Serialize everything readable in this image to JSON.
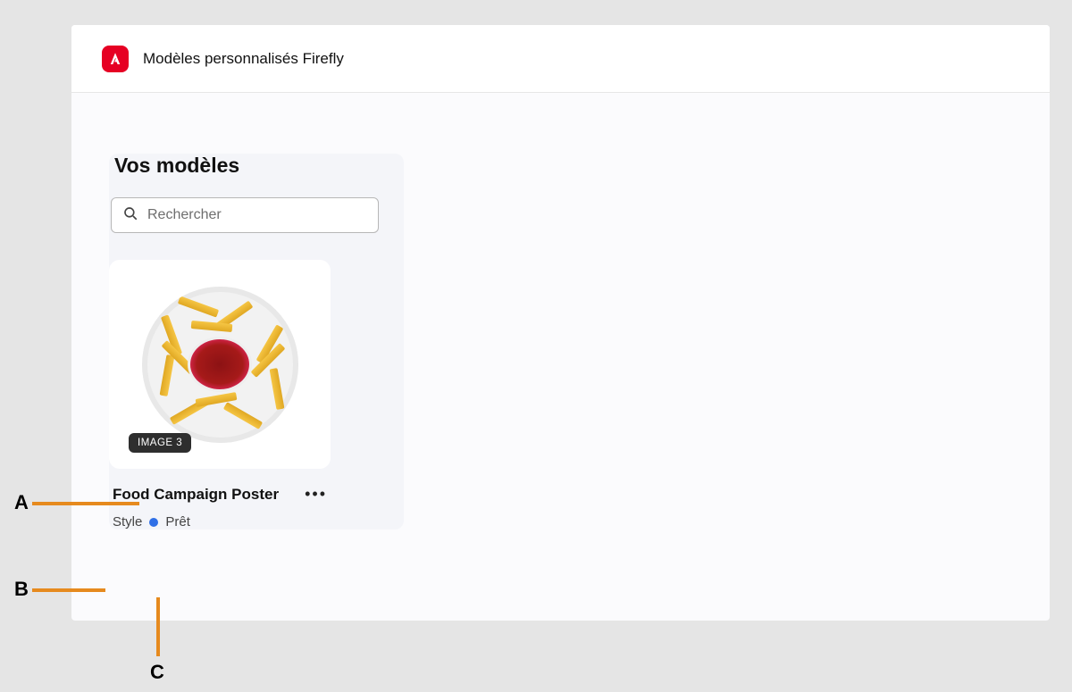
{
  "header": {
    "app_title": "Modèles personnalisés Firefly"
  },
  "sidebar": {
    "section_title": "Vos modèles",
    "search_placeholder": "Rechercher"
  },
  "model_card": {
    "badge": "IMAGE 3",
    "title": "Food Campaign Poster",
    "type_label": "Style",
    "status_label": "Prêt",
    "status_color": "#2f6fe6"
  },
  "annotations": {
    "a": "A",
    "b": "B",
    "c": "C"
  },
  "colors": {
    "accent_orange": "#e68a1e",
    "adobe_red": "#e60023"
  }
}
